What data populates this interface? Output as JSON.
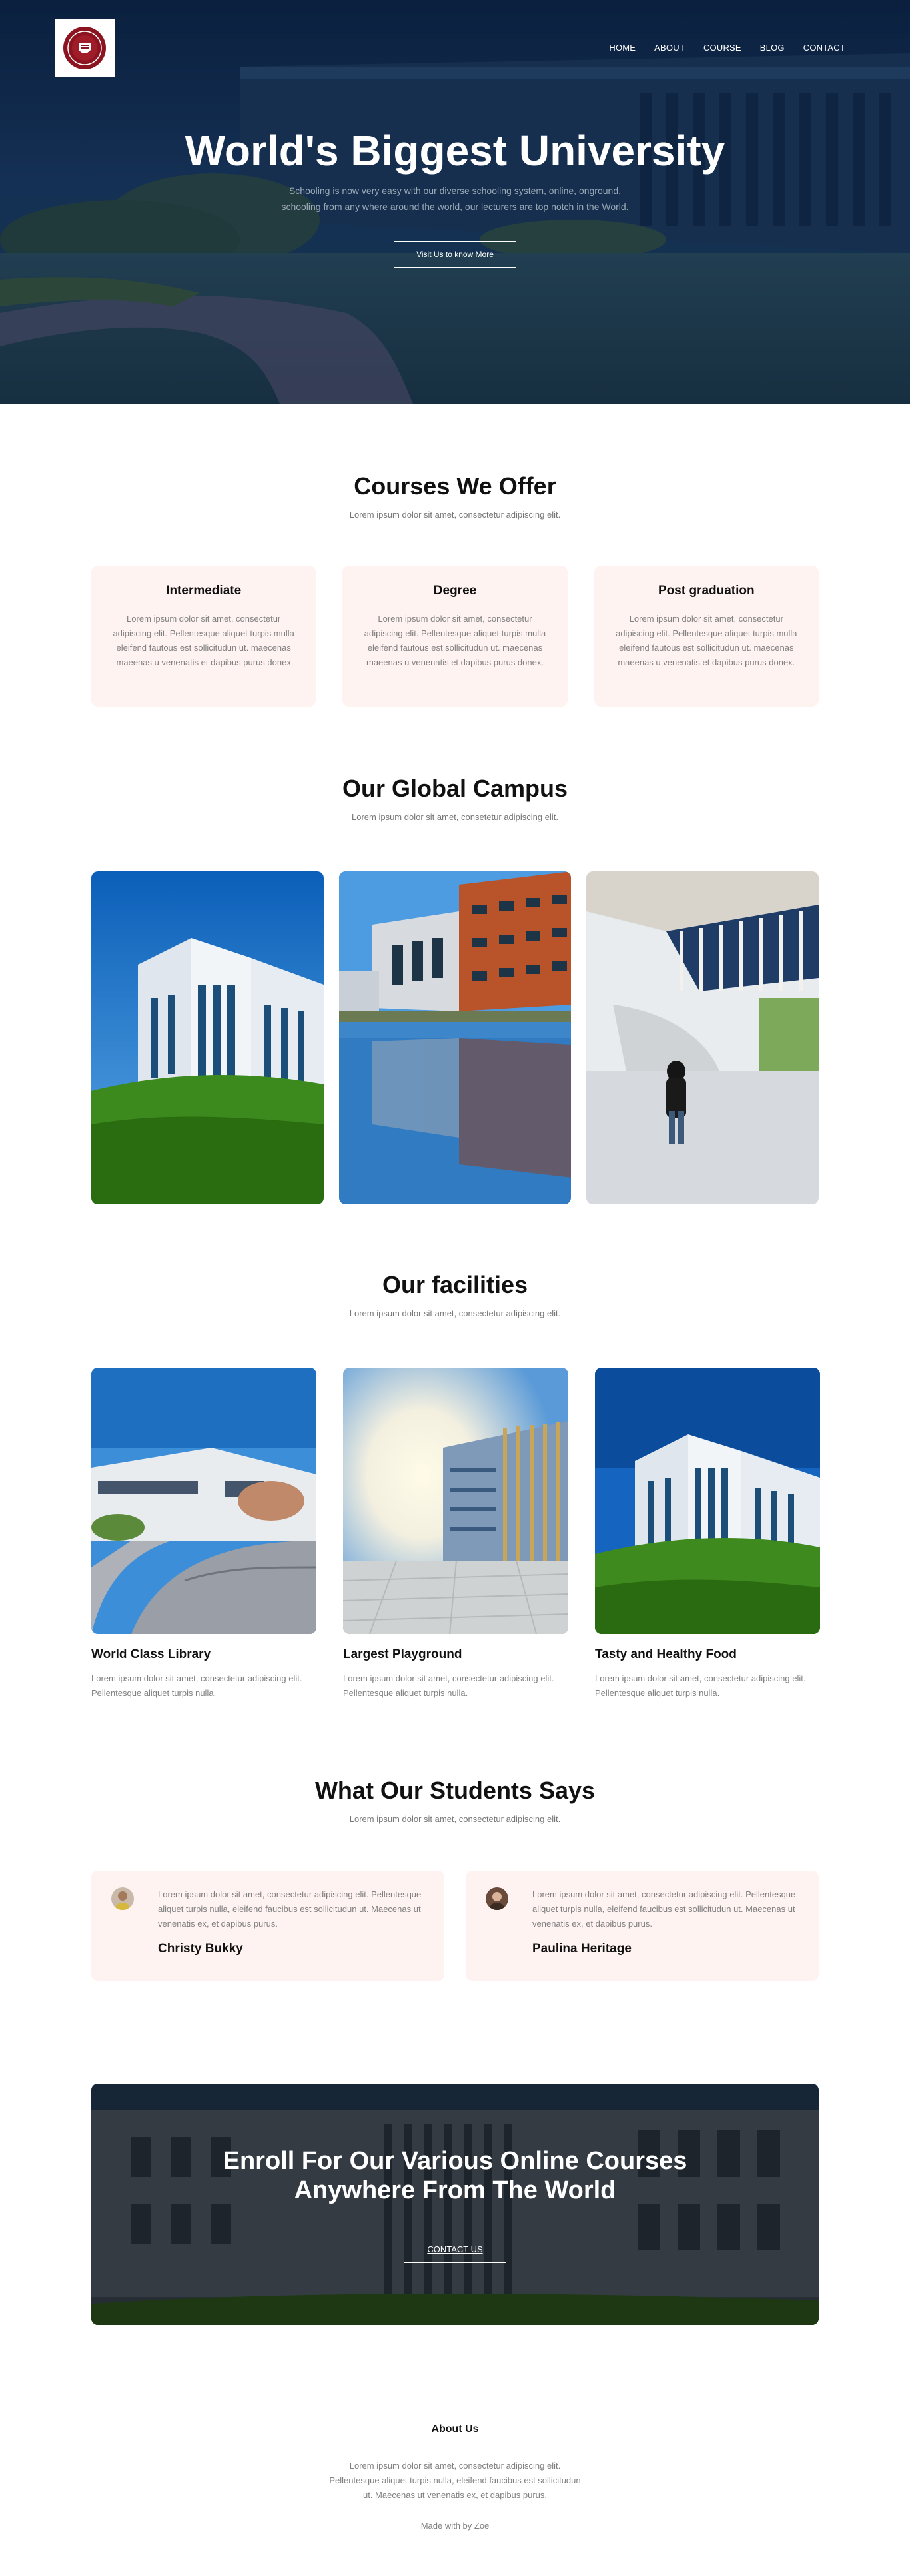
{
  "nav": {
    "items": [
      "HOME",
      "ABOUT",
      "COURSE",
      "BLOG",
      "CONTACT"
    ]
  },
  "hero": {
    "title": "World's Biggest University",
    "subtitle_line1": "Schooling is now very easy with our diverse schooling system, online, onground,",
    "subtitle_line2": "schooling from any where around the world, our lecturers are top notch in the World.",
    "button": "Visit Us to know More"
  },
  "courses": {
    "title": "Courses We Offer",
    "subtitle": "Lorem ipsum dolor sit amet, consectetur adipiscing elit.",
    "cards": [
      {
        "title": "Intermediate",
        "text": "Lorem ipsum dolor sit amet, consectetur adipiscing elit. Pellentesque aliquet turpis mulla eleifend fautous est sollicitudun ut. maecenas maeenas u venenatis et dapibus purus donex"
      },
      {
        "title": "Degree",
        "text": "Lorem ipsum dolor sit amet, consectetur adipiscing elit. Pellentesque aliquet turpis mulla eleifend fautous est sollicitudun ut. maecenas maeenas u venenatis et dapibus purus donex."
      },
      {
        "title": "Post graduation",
        "text": "Lorem ipsum dolor sit amet, consectetur adipiscing elit. Pellentesque aliquet turpis mulla eleifend fautous est sollicitudun ut. maecenas maeenas u venenatis et dapibus purus donex."
      }
    ]
  },
  "campus": {
    "title": "Our Global Campus",
    "subtitle": "Lorem ipsum dolor sit amet, consetetur adipiscing elit."
  },
  "facilities": {
    "title": "Our facilities",
    "subtitle": "Lorem ipsum dolor sit amet, consectetur adipiscing elit.",
    "cards": [
      {
        "title": "World Class Library",
        "text": "Lorem ipsum dolor sit amet, consectetur adipiscing elit. Pellentesque aliquet turpis nulla."
      },
      {
        "title": "Largest Playground",
        "text": "Lorem ipsum dolor sit amet, consectetur adipiscing elit. Pellentesque aliquet turpis nulla."
      },
      {
        "title": "Tasty and Healthy Food",
        "text": "Lorem ipsum dolor sit amet, consectetur adipiscing elit. Pellentesque aliquet turpis nulla."
      }
    ]
  },
  "testimonials": {
    "title": "What Our Students Says",
    "subtitle": "Lorem ipsum dolor sit amet, consectetur adipiscing elit.",
    "items": [
      {
        "name": "Christy Bukky",
        "text": "Lorem ipsum dolor sit amet, consectetur adipiscing elit. Pellentesque aliquet turpis nulla, eleifend faucibus est sollicitudun ut. Maecenas ut venenatis ex, et dapibus purus."
      },
      {
        "name": "Paulina Heritage",
        "text": "Lorem ipsum dolor sit amet, consectetur adipiscing elit. Pellentesque aliquet turpis nulla, eleifend faucibus est sollicitudun ut. Maecenas ut venenatis ex, et dapibus purus."
      }
    ]
  },
  "cta": {
    "title": "Enroll For Our Various Online Courses Anywhere From The World",
    "button": "CONTACT US"
  },
  "footer": {
    "title": "About Us",
    "text_line1": "Lorem ipsum dolor sit amet, consectetur adipiscing elit.",
    "text_line2": "Pellentesque aliquet turpis nulla, eleifend faucibus est sollicitudun",
    "text_line3": "ut. Maecenas ut venenatis ex, et dapibus purus.",
    "made_with": "Made with by Zoe"
  },
  "colors": {
    "card_bg": "#fff3f2",
    "hero_overlay": "#0c2141",
    "logo_crest": "#8b1420"
  }
}
